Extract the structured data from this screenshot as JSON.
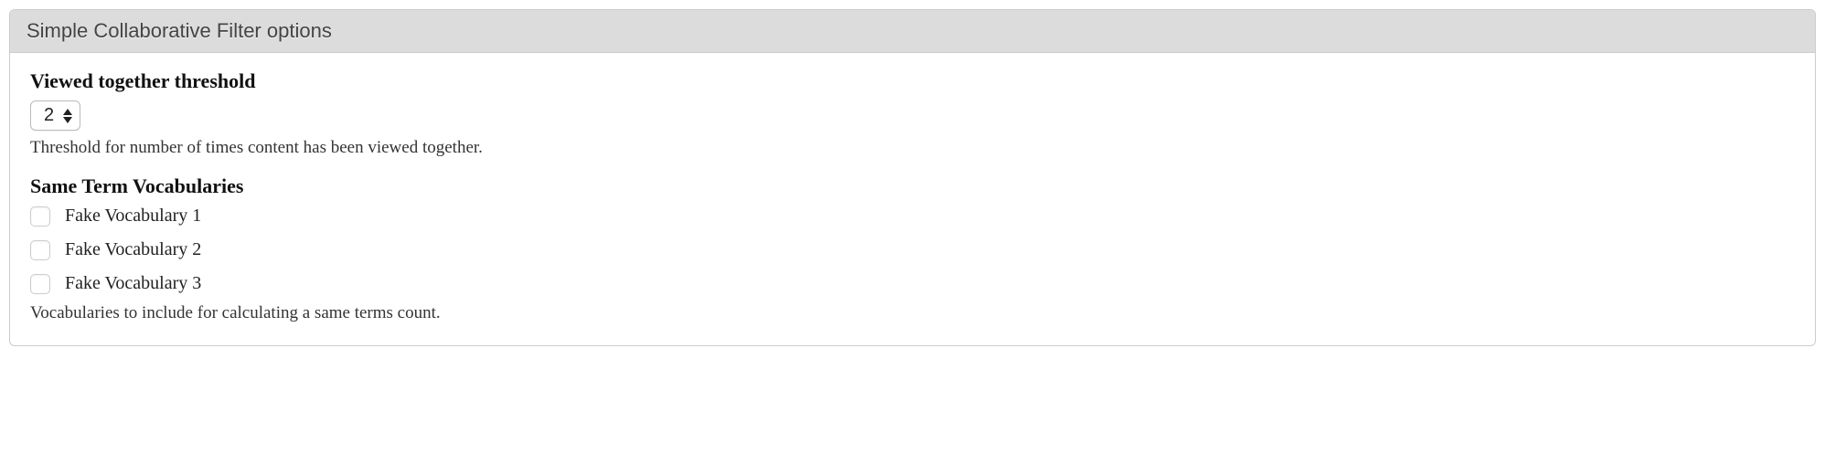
{
  "fieldset": {
    "title": "Simple Collaborative Filter options"
  },
  "threshold": {
    "label": "Viewed together threshold",
    "selected": "2",
    "description": "Threshold for number of times content has been viewed together."
  },
  "vocabularies": {
    "label": "Same Term Vocabularies",
    "items": [
      {
        "label": "Fake Vocabulary 1",
        "checked": false
      },
      {
        "label": "Fake Vocabulary 2",
        "checked": false
      },
      {
        "label": "Fake Vocabulary 3",
        "checked": false
      }
    ],
    "description": "Vocabularies to include for calculating a same terms count."
  }
}
